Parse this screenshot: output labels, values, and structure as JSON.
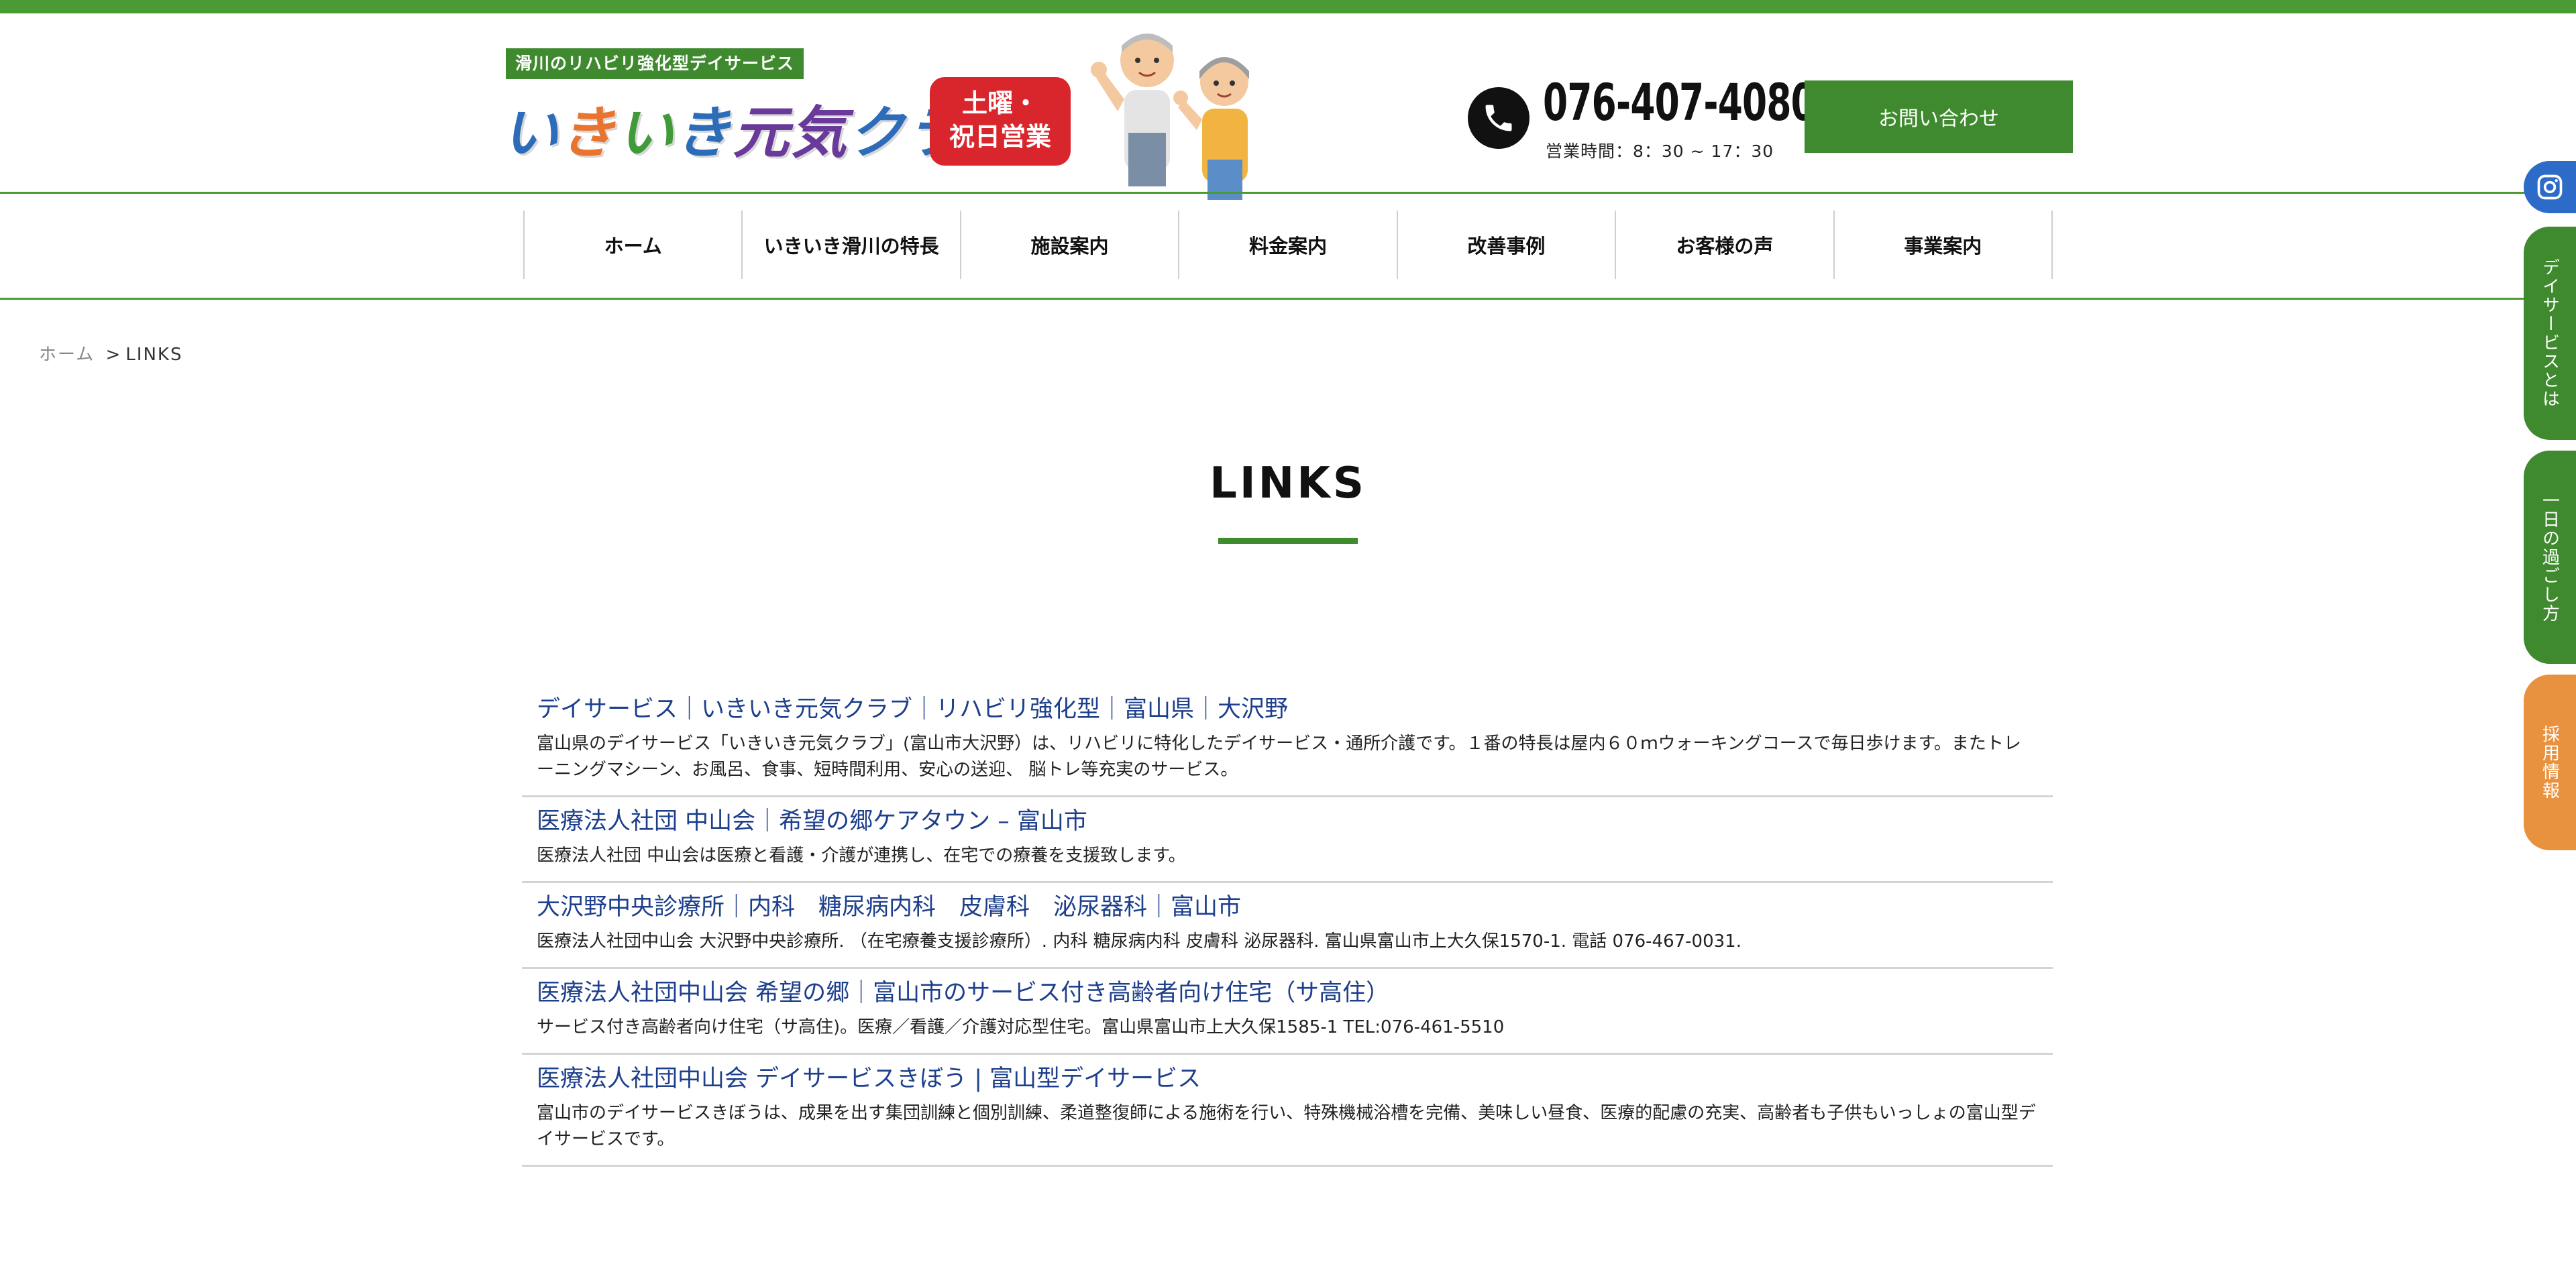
{
  "header": {
    "tagline": "滑川のリハビリ強化型デイサービス",
    "logo_parts": [
      "い",
      "き",
      "い",
      "き",
      "元気",
      "クラブ"
    ],
    "badge_line1": "土曜・",
    "badge_line2": "祝日営業",
    "phone": "076-407-4080",
    "hours": "営業時間：8：30 ~ 17：30",
    "contact_label": "お問い合わせ"
  },
  "nav": {
    "items": [
      {
        "label": "ホーム"
      },
      {
        "label": "いきいき滑川の特長"
      },
      {
        "label": "施設案内"
      },
      {
        "label": "料金案内"
      },
      {
        "label": "改善事例"
      },
      {
        "label": "お客様の声"
      },
      {
        "label": "事業案内"
      }
    ]
  },
  "breadcrumb": {
    "home": "ホーム",
    "separator": ">",
    "current": "LINKS"
  },
  "page_title": "LINKS",
  "links": [
    {
      "title": "デイサービス｜いきいき元気クラブ｜リハビリ強化型｜富山県｜大沢野",
      "description": "富山県のデイサービス「いきいき元気クラブ」(富山市大沢野）は、リハビリに特化したデイサービス・通所介護です。１番の特長は屋内６０ｍウォーキングコースで毎日歩けます。またトレーニングマシーン、お風呂、食事、短時間利用、安心の送迎、 脳トレ等充実のサービス。"
    },
    {
      "title": "医療法人社団 中山会｜希望の郷ケアタウン – 富山市",
      "description": "医療法人社団 中山会は医療と看護・介護が連携し、在宅での療養を支援致します。"
    },
    {
      "title": "大沢野中央診療所｜内科　糖尿病内科　皮膚科　泌尿器科｜富山市",
      "description": "医療法人社団中山会 大沢野中央診療所. （在宅療養支援診療所）. 内科 糖尿病内科 皮膚科 泌尿器科. 富山県富山市上大久保1570-1. 電話 076-467-0031."
    },
    {
      "title": "医療法人社団中山会 希望の郷｜富山市のサービス付き高齢者向け住宅（サ高住）",
      "description": "サービス付き高齢者向け住宅（サ高住)。医療／看護／介護対応型住宅。富山県富山市上大久保1585-1 TEL:076-461-5510"
    },
    {
      "title": "医療法人社団中山会 デイサービスきぼう | 富山型デイサービス",
      "description": "富山市のデイサービスきぼうは、成果を出す集団訓練と個別訓練、柔道整復師による施術を行い、特殊機械浴槽を完備、美味しい昼食、医療的配慮の充実、高齢者も子供もいっしょの富山型デイサービスです。"
    }
  ],
  "side_tabs": {
    "instagram_icon": "instagram-icon",
    "tab1": "デイサービスとは",
    "tab2": "一日の過ごし方",
    "tab3": "採用情報"
  },
  "colors": {
    "brand_green": "#3f8a2f",
    "link_blue": "#1d3f8c",
    "badge_red": "#d9262c",
    "recruit_orange": "#e8913f",
    "instagram_blue": "#2d6bc9"
  }
}
